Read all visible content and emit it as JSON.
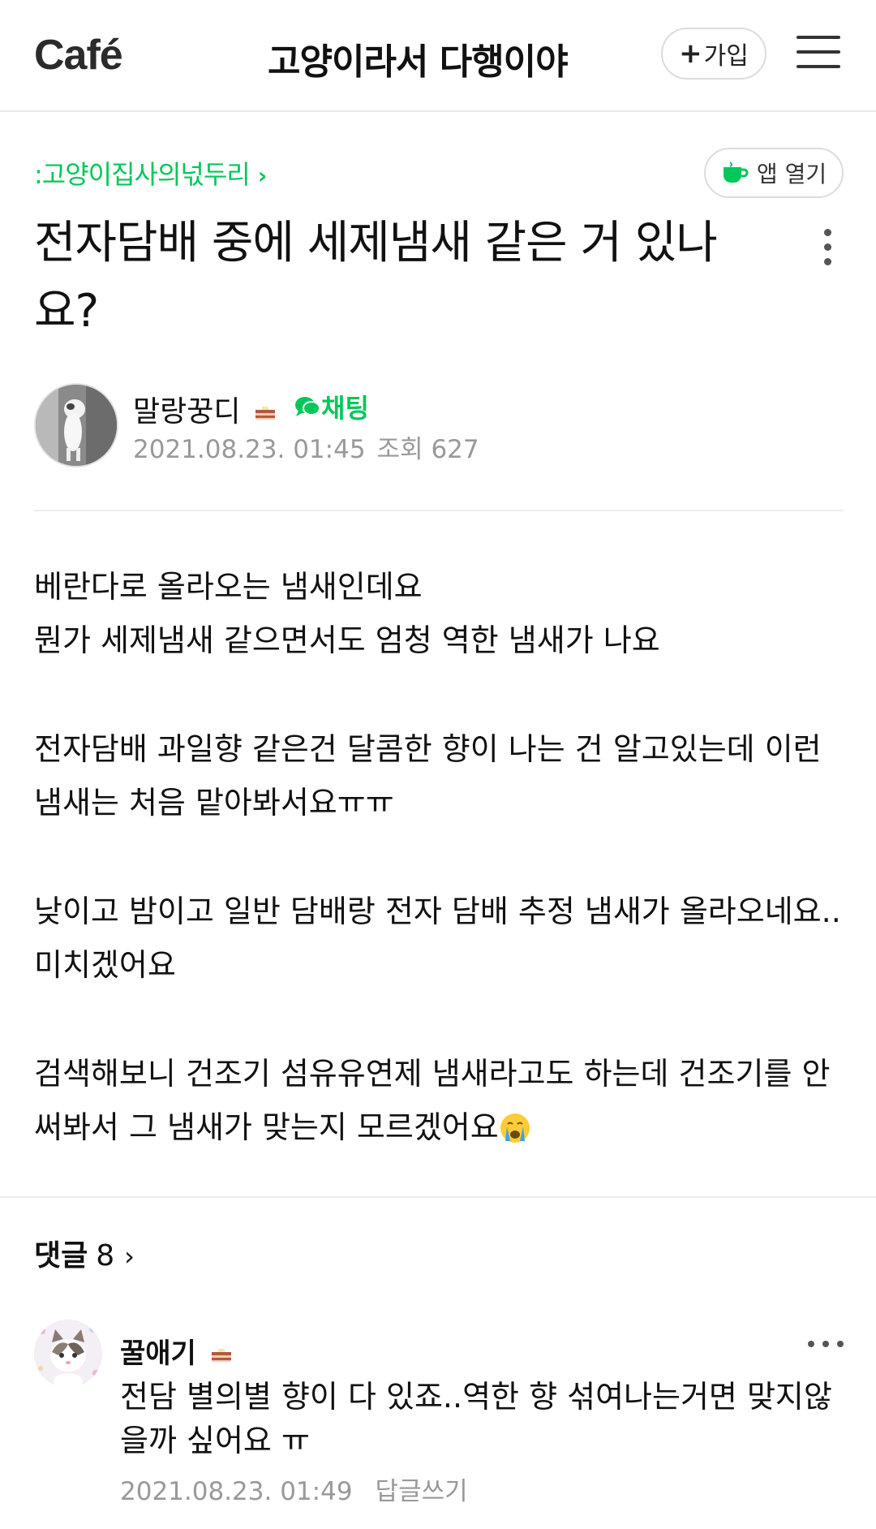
{
  "topbar": {
    "logo_text": "Caf",
    "logo_accent": "é",
    "cafe_name": "고양이라서 다행이야",
    "join_plus": "+",
    "join_label": "가입",
    "menu_icon": "hamburger-menu-icon"
  },
  "breadcrumb": {
    "board": ":고양이집사의넋두리",
    "chevron": "›"
  },
  "app_button": {
    "label": "앱 열기",
    "icon": "cafe-cup-icon"
  },
  "post": {
    "title": "전자담배 중에 세제냄새 같은 거 있나요?",
    "author": {
      "name": "말랑꿍디",
      "chat_label": "채팅",
      "date": "2021.08.23. 01:45",
      "views": "조회 627"
    },
    "body": {
      "p1_line1": "베란다로 올라오는 냄새인데요",
      "p1_line2": "뭔가 세제냄새 같으면서도 엄청 역한 냄새가 나요",
      "p2": "전자담배 과일향 같은건 달콤한 향이 나는 건 알고있는데 이런 냄새는 처음 맡아봐서요ㅠㅠ",
      "p3": "낮이고 밤이고 일반 담배랑 전자 담배 추정 냄새가 올라오네요.. 미치겠어요",
      "p4": "검색해보니 건조기 섬유유연제 냄새라고도 하는데 건조기를 안 써봐서 그 냄새가 맞는지 모르겠어요"
    }
  },
  "comments": {
    "label": "댓글",
    "count": "8",
    "chevron": "›",
    "items": [
      {
        "author": "꿀애기",
        "text": "전담 별의별 향이 다 있죠..역한 향 섞여나는거면 맞지않을까 싶어요 ㅠ",
        "date": "2021.08.23. 01:49",
        "reply_label": "답글쓰기"
      }
    ]
  },
  "colors": {
    "brand_green": "#03c75a",
    "meta_gray": "#999999"
  }
}
